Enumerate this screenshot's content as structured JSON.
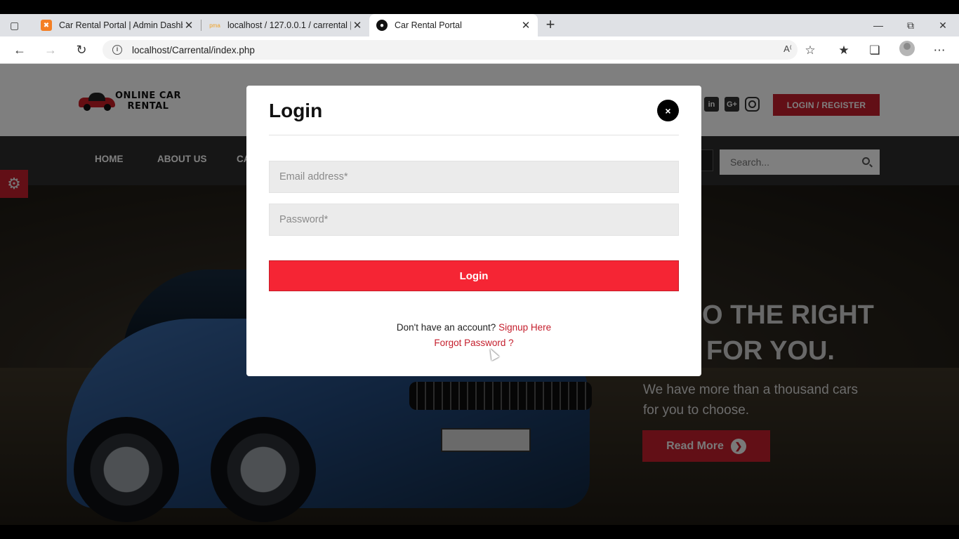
{
  "browser": {
    "tabs": [
      {
        "title": "Car Rental Portal | Admin Dashbc",
        "favicon": "xampp-icon",
        "active": false
      },
      {
        "title": "localhost / 127.0.0.1 / carrental |",
        "favicon": "phpmyadmin-icon",
        "active": false
      },
      {
        "title": "Car Rental Portal",
        "favicon": "site-icon",
        "active": true
      }
    ],
    "url": "localhost/Carrental/index.php"
  },
  "site": {
    "logo_line1": "ONLINE CAR",
    "logo_line2": "RENTAL",
    "login_register": "LOGIN / REGISTER",
    "social_icons": [
      "linkedin-icon",
      "google-plus-icon",
      "instagram-icon"
    ],
    "nav": [
      "HOME",
      "ABOUT US",
      "CA"
    ],
    "search_placeholder": "Search...",
    "hero_heading_line1": "O THE RIGHT",
    "hero_heading_line2": "FOR YOU.",
    "hero_sub": "We have more than a thousand cars for you to choose.",
    "read_more": "Read More"
  },
  "modal": {
    "title": "Login",
    "close": "×",
    "email_placeholder": "Email address*",
    "password_placeholder": "Password*",
    "login_button": "Login",
    "no_account": "Don't have an account?",
    "signup_link": "Signup Here",
    "forgot_link": "Forgot Password ?"
  },
  "colors": {
    "brand_red": "#c41e2c",
    "login_button": "#f52534"
  }
}
